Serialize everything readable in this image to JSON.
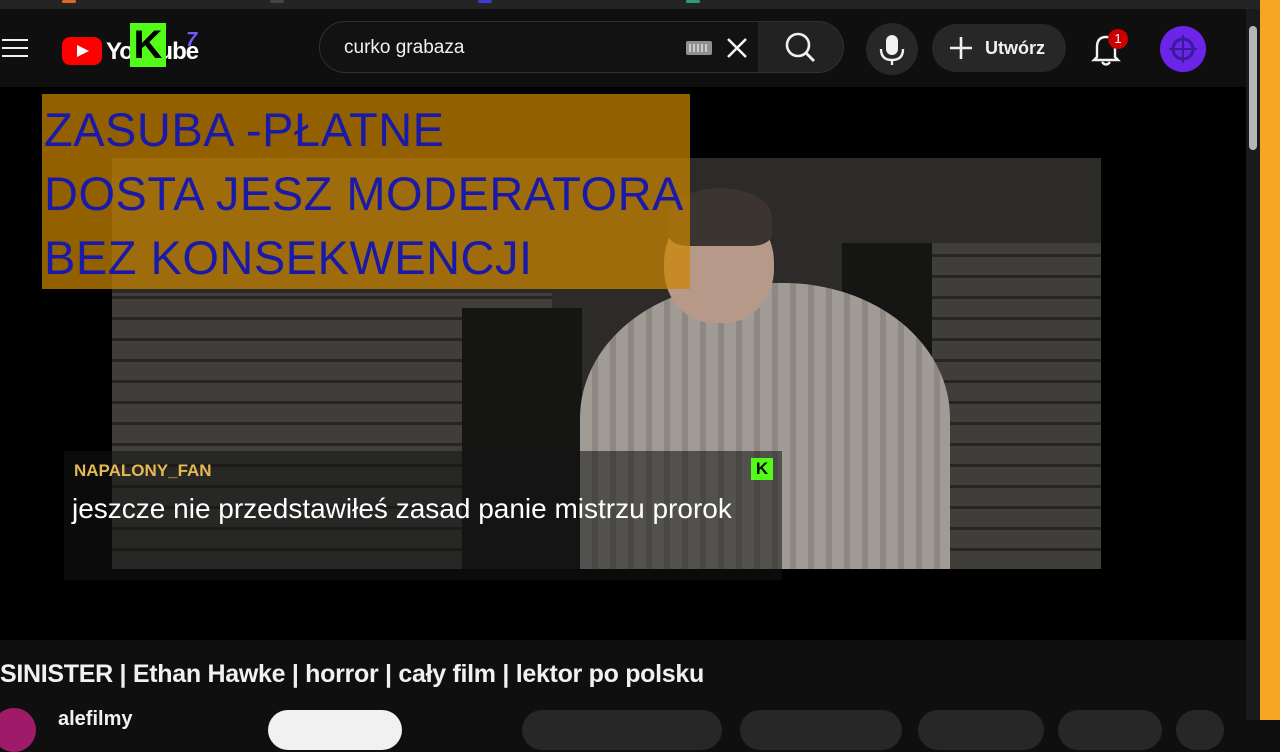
{
  "colors": {
    "background": "#0f0f0f",
    "brand_red": "#ff0000",
    "kick_green": "#53fc18",
    "overlay_orange": "#cc8500",
    "overlay_text": "#1a1aa8",
    "chat_username": "#e6b850",
    "edge_strip": "#f5a623"
  },
  "masthead": {
    "menu_icon": "hamburger-icon",
    "logo_text": "YouTube",
    "logo_overlay_letter": "K",
    "logo_overlay_suffix": "7",
    "search": {
      "value": "curko grabaza",
      "keyboard_icon": "keyboard-icon",
      "clear_icon": "close-icon",
      "search_icon": "search-icon"
    },
    "mic_icon": "microphone-icon",
    "create_label": "Utwórz",
    "notifications": {
      "icon": "bell-icon",
      "count": "1"
    },
    "avatar_icon": "avatar"
  },
  "player": {
    "moderator_overlay": {
      "lines": [
        "ZASUBA -PŁATNE",
        "DOSTA JESZ MODERATORA",
        "BEZ KONSEKWENCJI"
      ]
    },
    "chat": {
      "username": "NAPALONY_FAN",
      "badge": "K",
      "message": "jeszcze nie przedstawiłeś zasad panie mistrzu prorok"
    }
  },
  "video": {
    "title": "SINISTER | Ethan Hawke | horror | cały film | lektor po polsku",
    "channel_name": "alefilmy"
  }
}
